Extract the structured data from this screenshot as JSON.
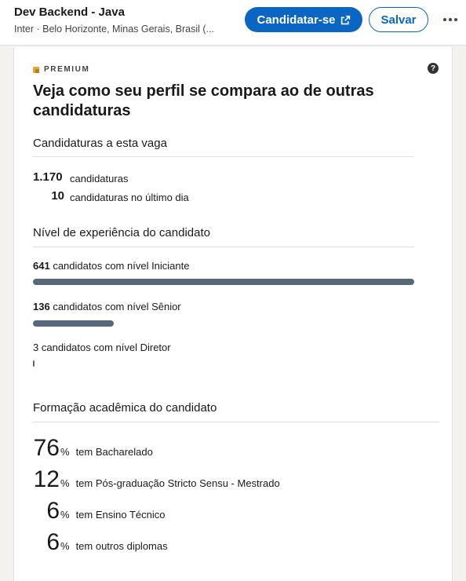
{
  "header": {
    "job_title": "Dev Backend - Java",
    "subtitle": "Inter · Belo Horizonte, Minas Gerais, Brasil (...",
    "apply_label": "Candidatar-se",
    "save_label": "Salvar"
  },
  "insights": {
    "premium_label": "PREMIUM",
    "heading": "Veja como seu perfil se compara ao de outras candidaturas",
    "applications": {
      "title": "Candidaturas a esta vaga",
      "total_value": "1.170",
      "total_label": "candidaturas",
      "last_day_value": "10",
      "last_day_label": "candidaturas no último dia"
    },
    "experience": {
      "title": "Nível de experiência do candidato",
      "levels": [
        {
          "count": "641",
          "label": "candidatos com nível Iniciante",
          "fraction": 1.0
        },
        {
          "count": "136",
          "label": "candidatos com nível Sênior",
          "fraction": 0.212
        },
        {
          "count": "3",
          "label": "candidatos com nível Diretor",
          "fraction": 0.005
        }
      ]
    },
    "education": {
      "title": "Formação acadêmica do candidato",
      "items": [
        {
          "value": "76",
          "unit": "%",
          "label": "tem Bacharelado"
        },
        {
          "value": "12",
          "unit": "%",
          "label": "tem Pós-graduação Stricto Sensu - Mestrado"
        },
        {
          "value": "6",
          "unit": "%",
          "label": "tem Ensino Técnico"
        },
        {
          "value": "6",
          "unit": "%",
          "label": "tem outros diplomas"
        }
      ]
    }
  },
  "colors": {
    "primary": "#0a66c2",
    "bar": "#56687a",
    "premium_gold": "#e7a33e"
  },
  "icons": {
    "external_link": "external-link-icon",
    "more": "more-icon",
    "help": "help-icon",
    "premium": "premium-icon"
  }
}
